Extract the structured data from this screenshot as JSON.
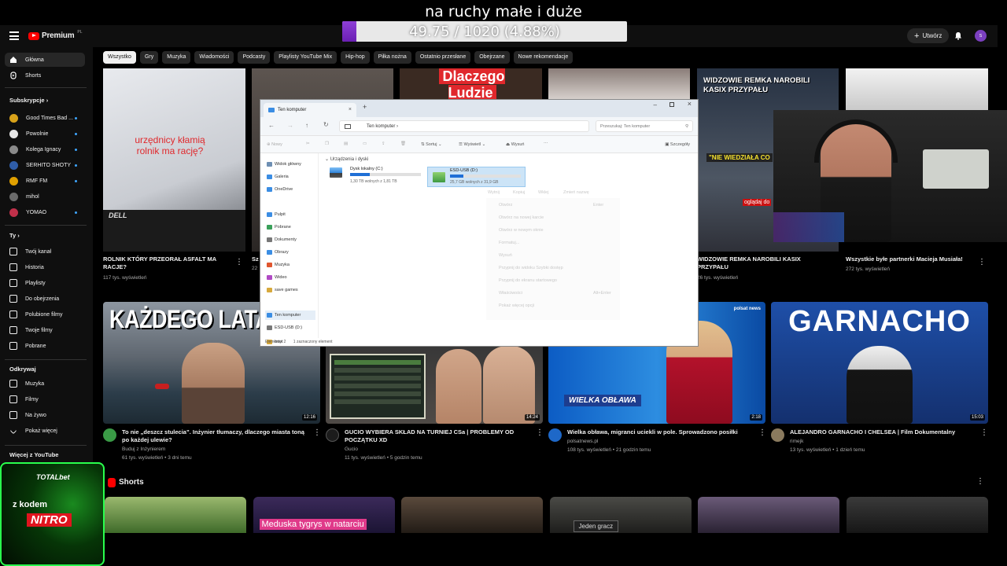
{
  "overlay": {
    "title": "na ruchy małe i duże",
    "progress_text": "49.75 / 1020 (4.88%)",
    "progress_fraction": 0.0488,
    "accent": "#7b2fc4"
  },
  "header": {
    "logo_text": "Premium",
    "logo_region": "PL",
    "create_label": "Utwórz",
    "avatar_letter": "s"
  },
  "chips": [
    "Wszystko",
    "Gry",
    "Muzyka",
    "Wiadomości",
    "Podcasty",
    "Playlisty YouTube Mix",
    "Hip-hop",
    "Piłka nożna",
    "Ostatnio przesłane",
    "Obejrzane",
    "Nowe rekomendacje"
  ],
  "sidebar": {
    "main": [
      {
        "label": "Główna",
        "icon": "home-icon"
      },
      {
        "label": "Shorts",
        "icon": "shorts-icon"
      }
    ],
    "subs_heading": "Subskrypcje",
    "subs": [
      {
        "label": "Good Times Bad ...",
        "color": "#d8a21a"
      },
      {
        "label": "Powolnie",
        "color": "#e6e6e6"
      },
      {
        "label": "Kolega Ignacy",
        "color": "#8a8a8a"
      },
      {
        "label": "SERHITO SHOTY",
        "color": "#2f5da8"
      },
      {
        "label": "RMF FM",
        "color": "#e0a000"
      },
      {
        "label": "mihol",
        "color": "#6b6b6b"
      },
      {
        "label": "YOMAO",
        "color": "#c0304a"
      }
    ],
    "you_heading": "Ty",
    "you": [
      {
        "label": "Twój kanał",
        "icon": "channel-icon"
      },
      {
        "label": "Historia",
        "icon": "history-icon"
      },
      {
        "label": "Playlisty",
        "icon": "playlist-icon"
      },
      {
        "label": "Do obejrzenia",
        "icon": "clock-icon"
      },
      {
        "label": "Polubione filmy",
        "icon": "like-icon"
      },
      {
        "label": "Twoje filmy",
        "icon": "video-icon"
      },
      {
        "label": "Pobrane",
        "icon": "download-icon"
      }
    ],
    "explore_heading": "Odkrywaj",
    "explore": [
      {
        "label": "Muzyka",
        "icon": "music-icon"
      },
      {
        "label": "Filmy",
        "icon": "film-icon"
      },
      {
        "label": "Na żywo",
        "icon": "live-icon"
      },
      {
        "label": "Pokaż więcej",
        "icon": "chevron-down-icon"
      }
    ],
    "more_heading": "Więcej z YouTube"
  },
  "row1": [
    {
      "title": "ROLNIK KTÓRY PRZEORAŁ ASFALT MA RACJE?",
      "meta": "117 tys. wyświetleń",
      "thumb_text": "urzędnicy kłamią rolnik ma rację?",
      "thumb_brand": "DELL"
    },
    {
      "title": "Sz",
      "meta": "22"
    },
    {
      "title": "",
      "meta": "",
      "thumb_text": "Dlaczego Ludzie"
    },
    {
      "title": "WIDZOWIE REMKA NAROBILI KASIX PRZYPAŁU",
      "meta": "26 tys. wyświetleń",
      "thumb_text": "WIDZOWIE REMKA NAROBILI KASIX PRZYPAŁU",
      "thumb_sub": "\"NIE WIEDZIAŁA CO",
      "thumb_tag": "oglądaj do"
    },
    {
      "title": "Wszystkie byłe partnerki Macieja Musiała!",
      "meta": "272 tys. wyświetleń"
    }
  ],
  "row2": [
    {
      "title": "To nie „deszcz stulecia”. Inżynier tłumaczy, dlaczego miasta toną po każdej ulewie?",
      "channel": "Buduj z Inżynierem",
      "meta": "61 tys. wyświetleń • 3 dni temu",
      "duration": "12:16",
      "thumb_text": "KAŻDEGO LATA TO"
    },
    {
      "title": "GUCIO WYBIERA SKŁAD NA TURNIEJ CSa | PROBLEMY OD POCZĄTKU XD",
      "channel": "Gucio",
      "meta": "11 tys. wyświetleń • 5 godzin temu",
      "duration": "14:24"
    },
    {
      "title": "Wielka obława, migranci uciekli w pole. Sprowadzono posiłki",
      "channel": "polsatnews.pl",
      "meta": "108 tys. wyświetleń • 21 godzin temu",
      "duration": "2:18",
      "thumb_text": "WIELKA OBŁAWA",
      "thumb_brand": "polsat news"
    },
    {
      "title": "ALEJANDRO GARNACHO I CHELSEA | Film Dokumentalny",
      "channel": "rimejk",
      "meta": "13 tys. wyświetleń • 1 dzień temu",
      "duration": "15:03",
      "thumb_text": "GARNACHO"
    }
  ],
  "shorts": {
    "heading": "Shorts",
    "items": [
      "",
      "Meduska tygrys w natarciu",
      "",
      "Jeden gracz",
      "",
      ""
    ]
  },
  "explorer": {
    "tab_title": "Ten komputer",
    "address": "Ten komputer",
    "search_placeholder": "Przeszukaj: Ten komputer",
    "toolbar": {
      "new": "Nowy",
      "sort": "Sortuj",
      "view": "Wyświetl",
      "eject": "Wysuń",
      "details": "Szczegóły"
    },
    "nav": [
      "Widok główny",
      "Galeria",
      "OneDrive",
      "Pulpit",
      "Pobrane",
      "Dokumenty",
      "Obrazy",
      "Muzyka",
      "Wideo",
      "save games",
      "Ten komputer",
      "ESD-USB (D:)",
      "boot"
    ],
    "section": "Urządzenia i dyski",
    "drives": [
      {
        "name": "Dysk lokalny (C:)",
        "free": "1,30 TB wolnych z 1,81 TB",
        "used_fraction": 0.28
      },
      {
        "name": "ESD-USB (D:)",
        "free": "25,7 GB wolnych z 31,9 GB",
        "used_fraction": 0.19
      }
    ],
    "status_left": "Elementy: 2",
    "status_right": "1 zaznaczony element",
    "context_top": [
      "Wytnij",
      "Kopiuj",
      "Wklej",
      "Zmień nazwę"
    ],
    "context": [
      "Otwórz",
      "Otwórz na nowej karcie",
      "Otwórz w nowym oknie",
      "Formatuj...",
      "Wysuń",
      "Przypnij do widoku Szybki dostęp",
      "Przypnij do ekranu startowego",
      "Właściwości",
      "Pokaż więcej opcji"
    ],
    "context_keys": [
      "Enter",
      "Alt+Enter"
    ]
  },
  "promo": {
    "brand": "TOTALbet",
    "line1": "z kodem",
    "code": "NITRO"
  }
}
